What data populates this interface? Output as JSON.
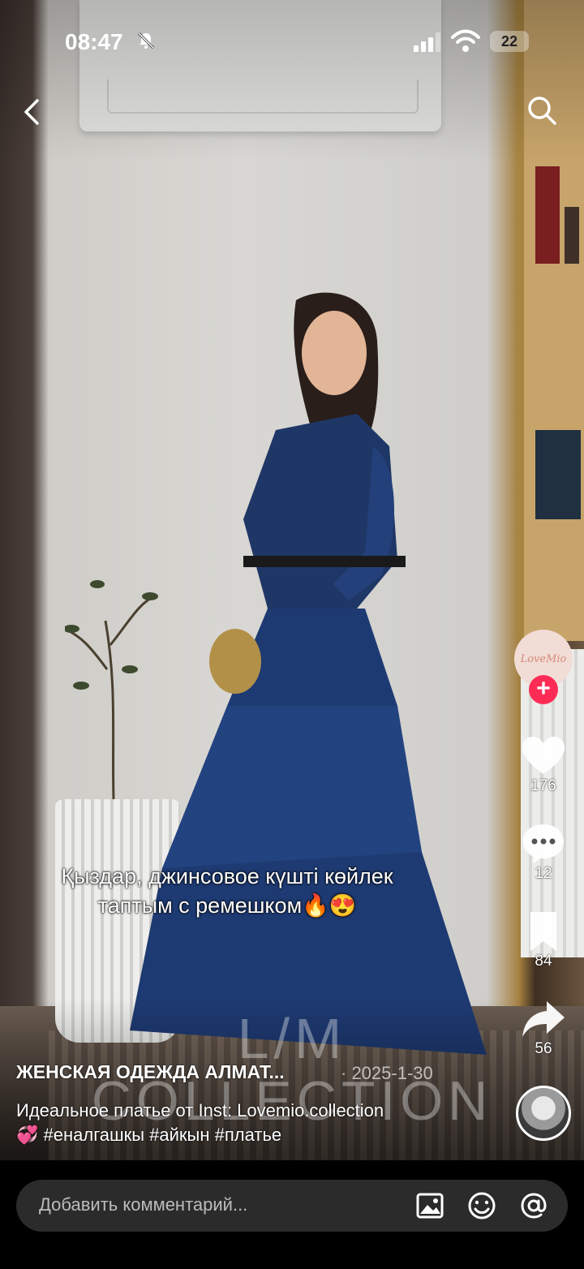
{
  "status_bar": {
    "time": "08:47",
    "battery": "22",
    "muted": true
  },
  "video": {
    "caption_line1": "Қыздар, джинсовое күшті көйлек",
    "caption_line2": "таптым с ремешком🔥😍",
    "watermark_top": "L/M",
    "watermark_bottom": "COLLECTION"
  },
  "creator": {
    "brand_avatar_text": "LoveMio",
    "follow_label": "+"
  },
  "actions": {
    "likes": "176",
    "comments": "12",
    "saves": "84",
    "shares": "56"
  },
  "post": {
    "author": "ЖЕНСКАЯ ОДЕЖДА АЛМАТ...",
    "date": "· 2025-1-30",
    "description_line1": "Идеальное платье от Inst: Lovemio.collection",
    "description_line2": "💞 #еналгашкы #айкын #платье"
  },
  "comment_bar": {
    "placeholder": "Добавить комментарий..."
  },
  "colors": {
    "like": "#ffffff",
    "follow": "#fe2c55"
  }
}
